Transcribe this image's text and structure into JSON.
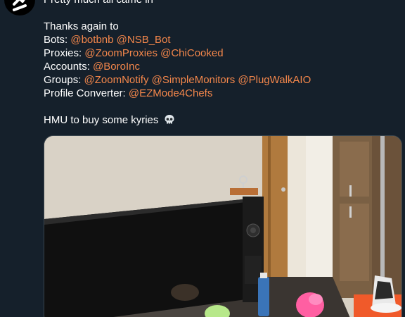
{
  "tweet": {
    "intro": "Pretty much all came in",
    "thanks": "Thanks again to",
    "credits": [
      {
        "label": "Bots:",
        "mentions": [
          "@botbnb",
          "@NSB_Bot"
        ]
      },
      {
        "label": "Proxies:",
        "mentions": [
          "@ZoomProxies",
          "@ChiCooked"
        ]
      },
      {
        "label": "Accounts:",
        "mentions": [
          "@BoroInc"
        ]
      },
      {
        "label": "Groups:",
        "mentions": [
          "@ZoomNotify",
          "@SimpleMonitors",
          "@PlugWalkAIO"
        ]
      },
      {
        "label": "Profile Converter:",
        "mentions": [
          "@EZMode4Chefs"
        ]
      }
    ],
    "closing": "HMU to buy some kyries",
    "closing_emoji": "skull-icon"
  },
  "colors": {
    "background": "#15202b",
    "text": "#ffffff",
    "mention": "#f4874b",
    "media_border": "#38444d"
  }
}
